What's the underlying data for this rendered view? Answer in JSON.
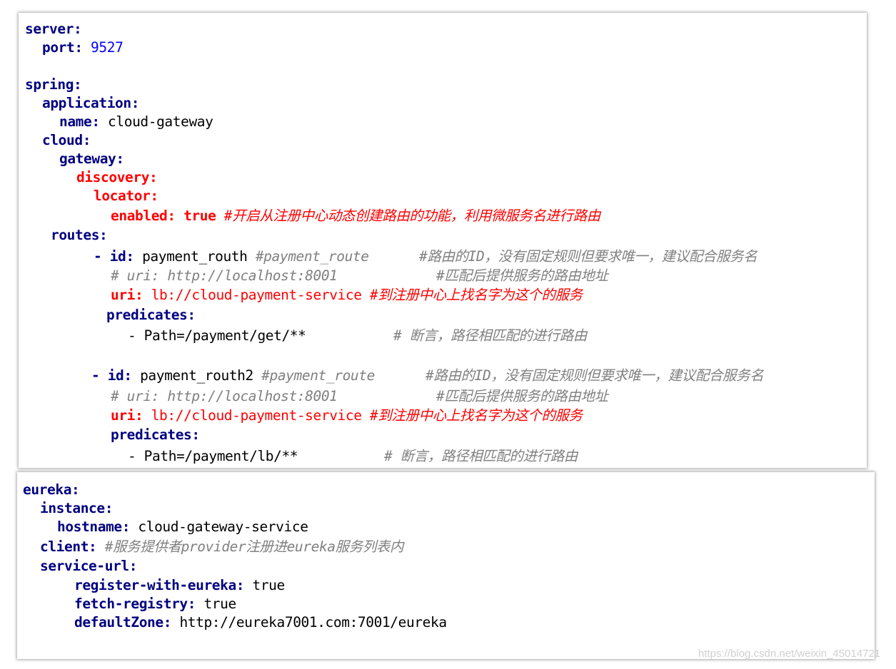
{
  "panel1": {
    "server_key": "server:",
    "port_key": "port:",
    "port_value": "9527",
    "spring_key": "spring:",
    "application_key": "application:",
    "name_key": "name:",
    "name_value": "cloud-gateway",
    "cloud_key": "cloud:",
    "gateway_key": "gateway:",
    "discovery_key": "discovery:",
    "locator_key": "locator:",
    "enabled_key": "enabled:",
    "enabled_value": "true",
    "enabled_comment": "#开启从注册中心动态创建路由的功能，利用微服务名进行路由",
    "routes_key": "routes:",
    "route1": {
      "dash": "- ",
      "id_key": "id:",
      "id_value": "payment_routh",
      "id_comment": "#payment_route",
      "id_comment2": "#路由的ID，没有固定规则但要求唯一，建议配合服务名",
      "uri_comment": "# uri: http://localhost:8001",
      "uri_comment2": "#匹配后提供服务的路由地址",
      "uri_key": "uri:",
      "uri_value": "lb://cloud-payment-service",
      "uri_note": "#到注册中心上找名字为这个的服务",
      "predicates_key": "predicates:",
      "path_value": "- Path=/payment/get/**",
      "path_comment": "# 断言，路径相匹配的进行路由"
    },
    "route2": {
      "dash": "- ",
      "id_key": "id:",
      "id_value": "payment_routh2",
      "id_comment": "#payment_route",
      "id_comment2": "#路由的ID，没有固定规则但要求唯一，建议配合服务名",
      "uri_comment": "# uri: http://localhost:8001",
      "uri_comment2": "#匹配后提供服务的路由地址",
      "uri_key": "uri:",
      "uri_value": "lb://cloud-payment-service",
      "uri_note": "#到注册中心上找名字为这个的服务",
      "predicates_key": "predicates:",
      "path_value": "- Path=/payment/lb/**",
      "path_comment": "# 断言，路径相匹配的进行路由"
    }
  },
  "panel2": {
    "eureka_key": "eureka:",
    "instance_key": "instance:",
    "hostname_key": "hostname:",
    "hostname_value": "cloud-gateway-service",
    "client_key": "client:",
    "client_comment": "#服务提供者provider注册进eureka服务列表内",
    "service_url_key": "service-url:",
    "register_key": "register-with-eureka:",
    "register_value": "true",
    "fetch_key": "fetch-registry:",
    "fetch_value": "true",
    "zone_key": "defaultZone:",
    "zone_value": "http://eureka7001.com:7001/eureka"
  },
  "watermark": "https://blog.csdn.net/weixin_45014721"
}
